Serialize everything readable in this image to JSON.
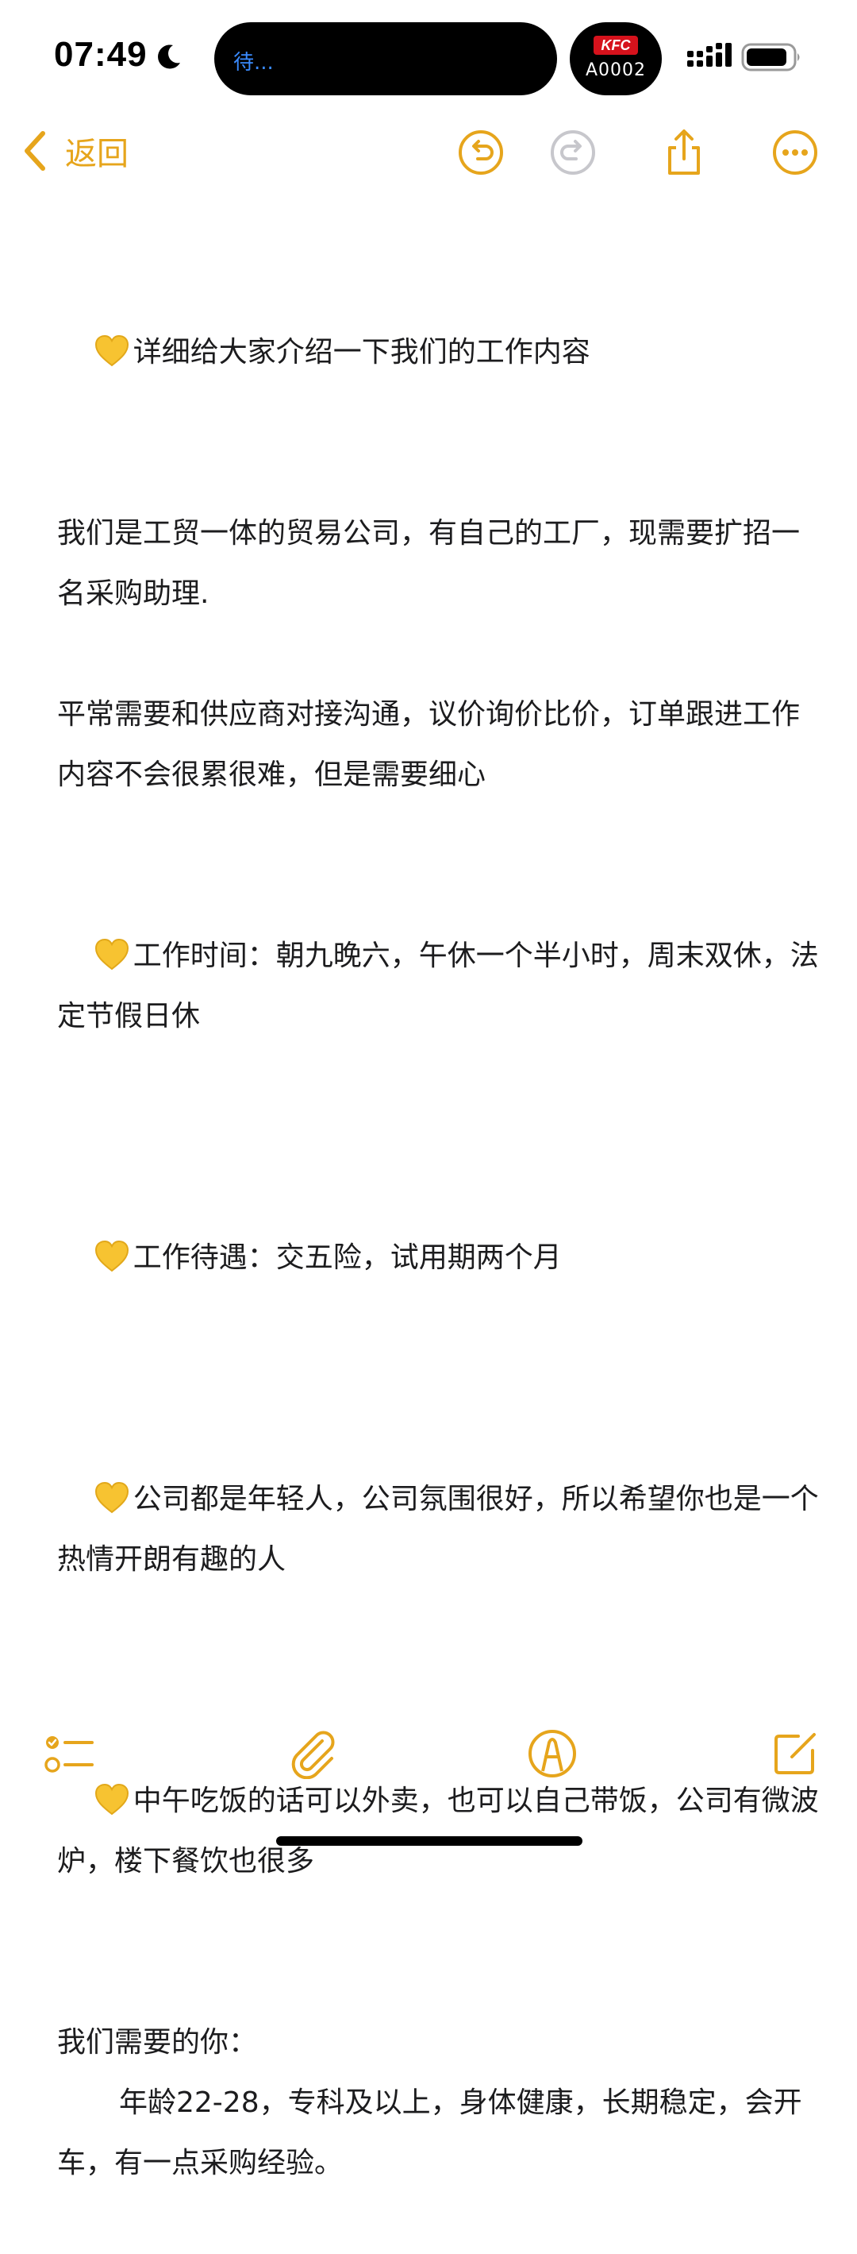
{
  "status_bar": {
    "time": "07:49",
    "island_text": "待...",
    "kfc_logo": "KFC",
    "kfc_code": "A0002"
  },
  "nav": {
    "back_label": "返回"
  },
  "colors": {
    "accent": "#e6a51c",
    "text": "#1c1c1e",
    "disabled": "#c7c7cc"
  },
  "icons": {
    "heart": "yellow-heart-icon",
    "undo": "undo-icon",
    "redo": "redo-icon",
    "share": "share-icon",
    "more": "more-icon",
    "checklist": "checklist-icon",
    "attach": "paperclip-icon",
    "markup": "markup-pen-icon",
    "compose": "compose-icon"
  },
  "note": {
    "intro": "详细给大家介绍一下我们的工作内容",
    "company": "我们是工贸一体的贸易公司，有自己的工厂，现需要扩招一名采购助理.",
    "duties": "平常需要和供应商对接沟通，议价询价比价，订单跟进工作内容不会很累很难，但是需要细心",
    "hours": "工作时间：朝九晚六，午休一个半小时，周末双休，法定节假日休",
    "benefits": "工作待遇：交五险，试用期两个月",
    "culture": "公司都是年轻人，公司氛围很好，所以希望你也是一个热情开朗有趣的人",
    "lunch": "中午吃饭的话可以外卖，也可以自己带饭，公司有微波炉，楼下餐饮也很多",
    "req_title": "我们需要的你：",
    "req_body": "年龄22-28，专科及以上，身体健康，长期稳定，会开车，有一点采购经验。"
  }
}
